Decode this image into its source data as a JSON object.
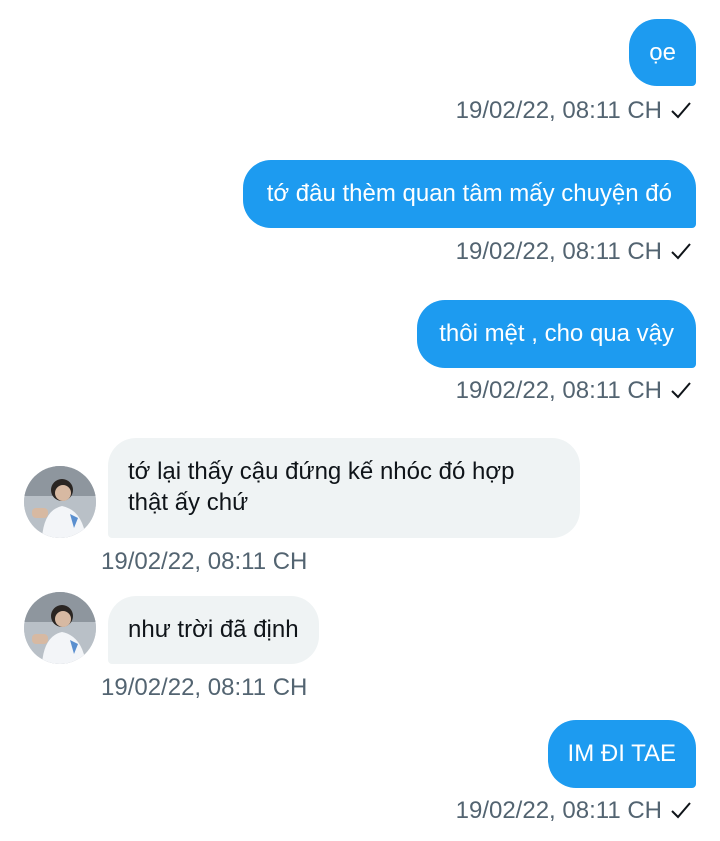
{
  "messages": [
    {
      "direction": "out",
      "text": "ọe",
      "time": "19/02/22, 08:11 CH",
      "read_icon": "check-icon"
    },
    {
      "direction": "out",
      "text": "tớ đâu thèm quan tâm mấy chuyện đó",
      "time": "19/02/22, 08:11 CH",
      "read_icon": "check-icon"
    },
    {
      "direction": "out",
      "text": "thôi mệt , cho qua vậy",
      "time": "19/02/22, 08:11 CH",
      "read_icon": "check-icon"
    },
    {
      "direction": "in",
      "text": "tớ lại thấy cậu đứng kế nhóc đó hợp thật ấy chứ",
      "time": "19/02/22, 08:11 CH",
      "avatar_icon": "avatar"
    },
    {
      "direction": "in",
      "text": "như trời đã định",
      "time": "19/02/22, 08:11 CH",
      "avatar_icon": "avatar"
    },
    {
      "direction": "out",
      "text": "IM ĐI TAE",
      "time": "19/02/22, 08:11 CH",
      "read_icon": "check-icon"
    }
  ],
  "colors": {
    "outgoing_bubble": "#1d9bf0",
    "incoming_bubble": "#eff3f4",
    "timestamp": "#536471"
  }
}
